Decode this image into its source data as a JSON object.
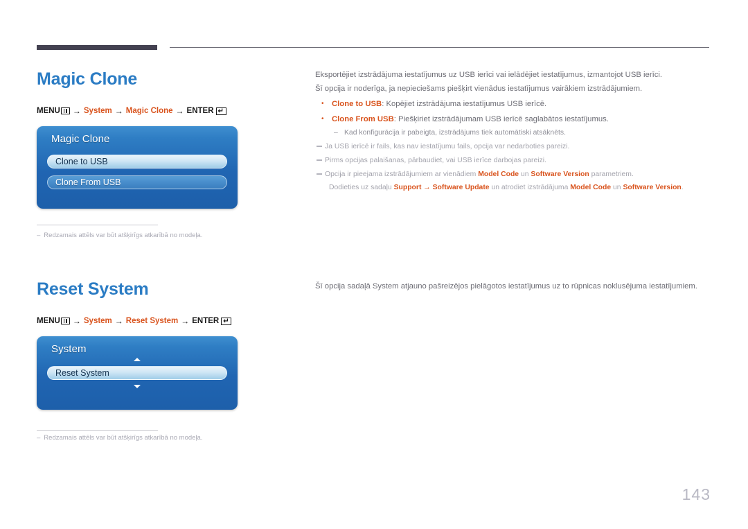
{
  "page": {
    "number": "143"
  },
  "sections": [
    {
      "id": "magic-clone",
      "heading": "Magic Clone",
      "menu_path": {
        "menu_label": "MENU",
        "arrow": "→",
        "step1": "System",
        "step2": "Magic Clone",
        "enter_label": "ENTER",
        "enter_glyph": "↵"
      },
      "osd": {
        "title": "Magic Clone",
        "items": [
          {
            "label": "Clone to USB",
            "selected": true
          },
          {
            "label": "Clone From USB",
            "selected": false
          }
        ]
      },
      "footnote": {
        "dash": "–",
        "text": "Redzamais attēls var būt atšķirīgs atkarībā no modeļa."
      },
      "body": {
        "paragraphs": [
          "Eksportējiet izstrādājuma iestatījumus uz USB ierīci vai ielādējiet iestatījumus, izmantojot USB ierīci.",
          "Šī opcija ir noderīga, ja nepieciešams piešķirt vienādus iestatījumus vairākiem izstrādājumiem."
        ],
        "bullets": [
          {
            "term": "Clone to USB",
            "rest": ": Kopējiet izstrādājuma iestatījumus USB ierīcē."
          },
          {
            "term": "Clone From USB",
            "rest": ": Piešķiriet izstrādājumam USB ierīcē saglabātos iestatījumus."
          }
        ],
        "subdash": "Kad konfigurācija ir pabeigta, izstrādājums tiek automātiski atsāknēts.",
        "notes": [
          {
            "text": "Ja USB ierīcē ir fails, kas nav iestatījumu fails, opcija var nedarboties pareizi."
          },
          {
            "text": "Pirms opcijas palaišanas, pārbaudiet, vai USB ierīce darbojas pareizi."
          }
        ],
        "note_rich": {
          "pre": "Opcija ir pieejama izstrādājumiem ar vienādiem ",
          "b1": "Model Code",
          "mid1": " un ",
          "b2": "Software Version",
          "post": " parametriem."
        },
        "note_cont": {
          "pre": "Dodieties uz sadaļu ",
          "b1": "Support",
          "arrow": " → ",
          "b2": "Software Update",
          "mid": " un atrodiet izstrādājuma ",
          "b3": "Model Code",
          "mid2": " un ",
          "b4": "Software Version",
          "post": "."
        }
      }
    },
    {
      "id": "reset-system",
      "heading": "Reset System",
      "menu_path": {
        "menu_label": "MENU",
        "arrow": "→",
        "step1": "System",
        "step2": "Reset System",
        "enter_label": "ENTER",
        "enter_glyph": "↵"
      },
      "osd": {
        "title": "System",
        "items": [
          {
            "label": "Reset System",
            "selected": true
          }
        ]
      },
      "footnote": {
        "dash": "–",
        "text": "Redzamais attēls var būt atšķirīgs atkarībā no modeļa."
      },
      "body": {
        "paragraphs": [
          "Šī opcija sadaļā System atjauno pašreizējos pielāgotos iestatījumus uz to rūpnicas noklusējuma iestatījumiem."
        ]
      }
    }
  ],
  "colors": {
    "heading_blue": "#2b7cc4",
    "accent_orange": "#d9541e",
    "rule_dark": "#434150",
    "body_gray": "#6d6d75",
    "note_gray": "#a4a4ad",
    "osd_blue": "#2065b2"
  }
}
